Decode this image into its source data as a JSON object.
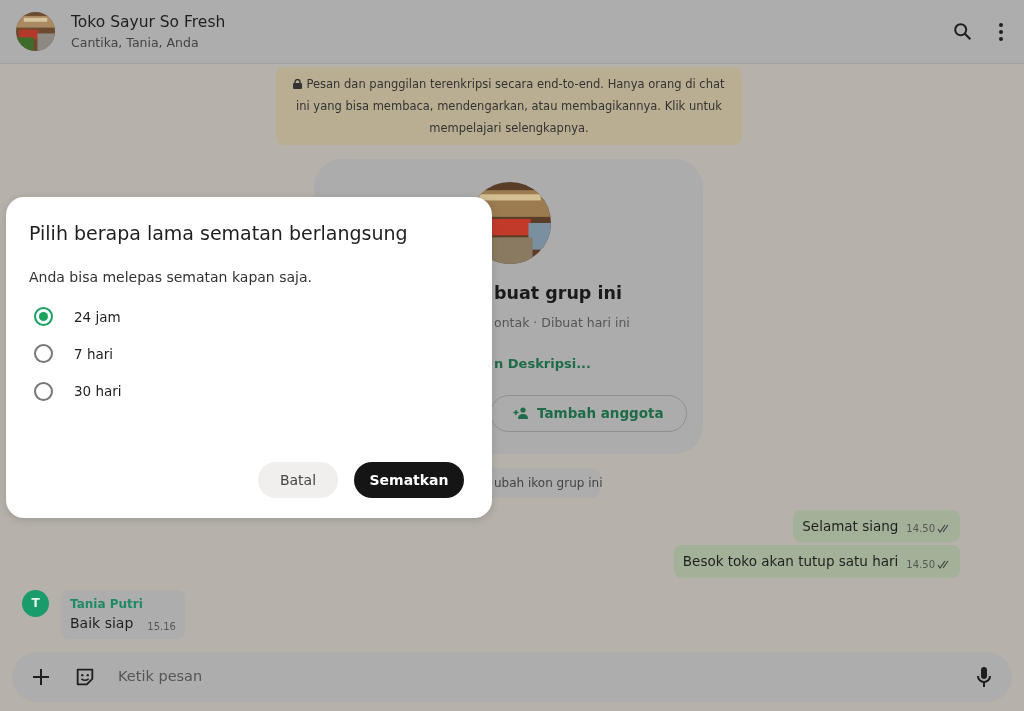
{
  "header": {
    "title": "Toko Sayur So Fresh",
    "subtitle": "Cantika, Tania, Anda"
  },
  "encryption_notice": {
    "text": "Pesan dan panggilan terenkripsi secara end-to-end. Hanya orang di chat ini yang bisa membaca, mendengarkan, atau membagikannya. Klik untuk mempelajari selengkapnya."
  },
  "group_card": {
    "title": "buat grup ini",
    "meta": "ontak · Dibuat hari ini",
    "description_link": "n Deskripsi...",
    "add_button": "Tambah anggota"
  },
  "system_message": "ubah ikon grup ini",
  "messages": [
    {
      "kind": "outgoing",
      "text": "Selamat siang",
      "time": "14.50",
      "read": true
    },
    {
      "kind": "outgoing",
      "text": "Besok toko akan tutup satu hari",
      "time": "14.50",
      "read": true
    },
    {
      "kind": "incoming",
      "sender": "Tania Putri",
      "initial": "T",
      "text": "Baik siap",
      "time": "15.16"
    }
  ],
  "composer": {
    "placeholder": "Ketik pesan"
  },
  "dialog": {
    "title": "Pilih berapa lama sematan berlangsung",
    "description": "Anda bisa melepas sematan kapan saja.",
    "options": [
      {
        "label": "24 jam",
        "selected": true
      },
      {
        "label": "7 hari",
        "selected": false
      },
      {
        "label": "30 hari",
        "selected": false
      }
    ],
    "cancel_button": "Batal",
    "confirm_button": "Sematkan"
  }
}
